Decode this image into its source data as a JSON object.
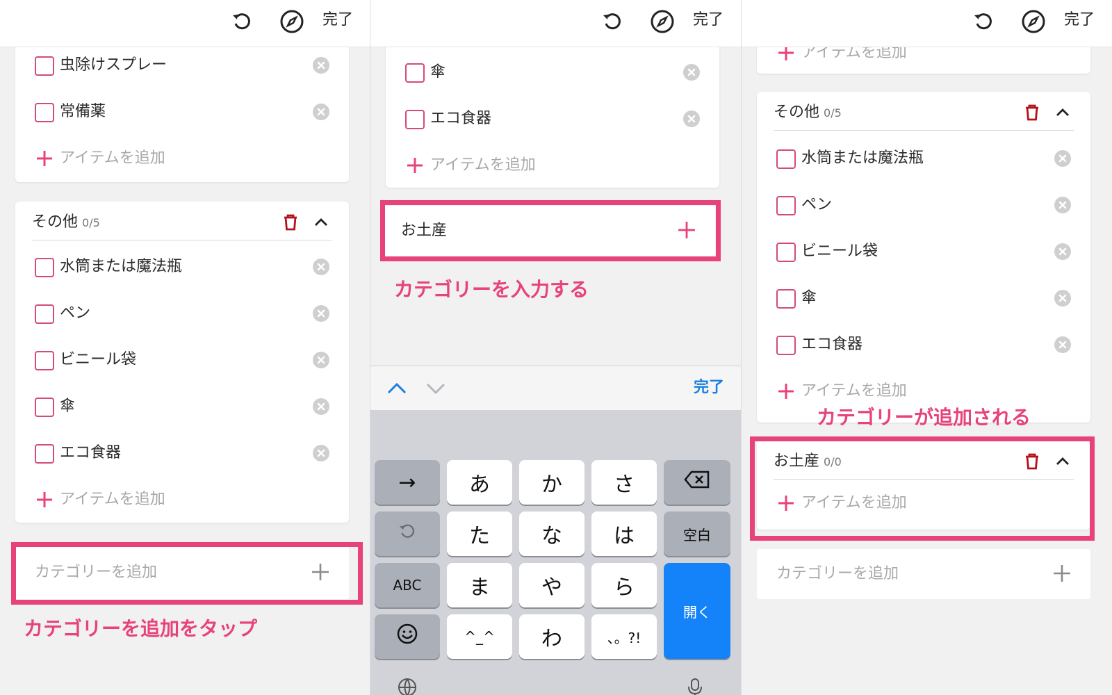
{
  "header": {
    "done_label": "完了"
  },
  "colors": {
    "accent_pink": "#e8427a",
    "checkbox_border": "#d44b7a",
    "trash_red": "#b3121b",
    "keyboard_blue": "#1483fa",
    "link_blue": "#1a7fe0"
  },
  "panel1": {
    "top_items": [
      "虫除けスプレー",
      "常備薬"
    ],
    "add_item_label": "アイテムを追加",
    "category": {
      "name": "その他",
      "count": "0/5",
      "items": [
        "水筒または魔法瓶",
        "ペン",
        "ビニール袋",
        "傘",
        "エコ食器"
      ]
    },
    "add_item_label_2": "アイテムを追加",
    "add_category_placeholder": "カテゴリーを追加",
    "caption": "カテゴリーを追加をタップ"
  },
  "panel2": {
    "top_items": [
      "傘",
      "エコ食器"
    ],
    "add_item_label": "アイテムを追加",
    "category_input_value": "お土産",
    "caption": "カテゴリーを入力する",
    "keyboard_done": "完了",
    "keys": {
      "row1": [
        "→",
        "あ",
        "か",
        "さ"
      ],
      "row2": [
        "た",
        "な",
        "は",
        "空白"
      ],
      "row3": [
        "ABC",
        "ま",
        "や",
        "ら"
      ],
      "row4": [
        "^_^",
        "わ",
        "、。?!"
      ],
      "open": "開く"
    }
  },
  "panel3": {
    "top_add_item_label": "アイテムを追加",
    "category": {
      "name": "その他",
      "count": "0/5",
      "items": [
        "水筒または魔法瓶",
        "ペン",
        "ビニール袋",
        "傘",
        "エコ食器"
      ]
    },
    "add_item_label": "アイテムを追加",
    "caption": "カテゴリーが追加される",
    "new_category": {
      "name": "お土産",
      "count": "0/0"
    },
    "new_add_item_label": "アイテムを追加",
    "add_category_placeholder": "カテゴリーを追加"
  }
}
